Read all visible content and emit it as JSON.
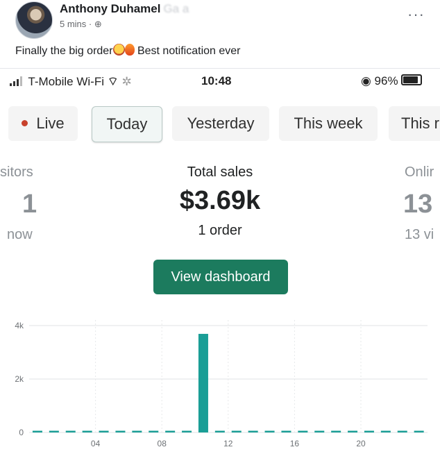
{
  "post": {
    "author": "Anthony Duhamel",
    "author_suffix": "Ga  a",
    "meta": "5 mins · ⊕",
    "caption_part1": "Finally the big order",
    "caption_part2": " Best notification ever",
    "emoji_icons": [
      "star-struck-icon",
      "fire-icon"
    ],
    "more": "···"
  },
  "statusbar": {
    "carrier": "T-Mobile Wi-Fi",
    "wifi_icon": "⁠☰",
    "loading": "✲",
    "time": "10:48",
    "battery_text": "◉ 96%"
  },
  "tabs": [
    {
      "label": "Live",
      "active": false
    },
    {
      "label": "Today",
      "active": true
    },
    {
      "label": "Yesterday",
      "active": false
    },
    {
      "label": "This week",
      "active": false
    },
    {
      "label": "This r",
      "active": false
    }
  ],
  "metrics": {
    "left": {
      "label": "sitors",
      "value": "1",
      "sub": "now"
    },
    "center": {
      "label": "Total sales",
      "value": "$3.69k",
      "sub": "1 order"
    },
    "right": {
      "label": "Onlir",
      "value": "13",
      "sub": "13 vi"
    }
  },
  "view_dashboard": "View dashboard",
  "colors": {
    "accent": "#1c7b5e",
    "bar": "#1a9e96",
    "live": "#c8412c"
  },
  "chart_data": {
    "type": "bar",
    "x": [
      0,
      1,
      2,
      3,
      4,
      5,
      6,
      7,
      8,
      9,
      10,
      11,
      12,
      13,
      14,
      15,
      16,
      17,
      18,
      19,
      20,
      21,
      22,
      23
    ],
    "values": [
      0,
      0,
      0,
      0,
      0,
      0,
      0,
      0,
      0,
      0,
      3690,
      0,
      0,
      0,
      0,
      0,
      0,
      0,
      0,
      0,
      0,
      0,
      0,
      0
    ],
    "ytick_labels": [
      "0",
      "2k",
      "4k"
    ],
    "ytick_values": [
      0,
      2000,
      4000
    ],
    "xtick_labels": [
      "04",
      "08",
      "12",
      "16",
      "20"
    ],
    "xtick_values": [
      4,
      8,
      12,
      16,
      20
    ],
    "ylim": [
      0,
      4000
    ],
    "grid": true
  }
}
